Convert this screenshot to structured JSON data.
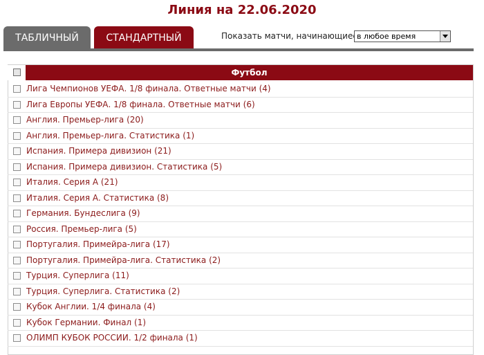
{
  "page": {
    "title": "Линия на 22.06.2020"
  },
  "tabs": [
    {
      "label": "ТАБЛИЧНЫЙ",
      "active": false
    },
    {
      "label": "СТАНДАРТНЫЙ",
      "active": true
    }
  ],
  "filter": {
    "label": "Показать матчи, начинающиеся",
    "selected": "в любое время"
  },
  "table": {
    "header": "Футбол",
    "rows": [
      {
        "label": "Лига Чемпионов УЕФА. 1/8 финала. Ответные матчи (4)"
      },
      {
        "label": "Лига Европы УЕФА. 1/8 финала. Ответные матчи (6)"
      },
      {
        "label": "Англия. Премьер-лига (20)"
      },
      {
        "label": "Англия. Премьер-лига. Статистика (1)"
      },
      {
        "label": "Испания. Примера дивизион (21)"
      },
      {
        "label": "Испания. Примера дивизион. Статистика (5)"
      },
      {
        "label": "Италия. Серия А (21)"
      },
      {
        "label": "Италия. Серия А. Статистика (8)"
      },
      {
        "label": "Германия. Бундеслига (9)"
      },
      {
        "label": "Россия. Премьер-лига (5)"
      },
      {
        "label": "Португалия. Примейра-лига (17)"
      },
      {
        "label": "Португалия. Примейра-лига. Статистика (2)"
      },
      {
        "label": "Турция. Суперлига (11)"
      },
      {
        "label": "Турция. Суперлига. Статистика (2)"
      },
      {
        "label": "Кубок Англии. 1/4 финала (4)"
      },
      {
        "label": "Кубок Германии. Финал (1)"
      },
      {
        "label": "ОЛИМП КУБОК РОССИИ. 1/2 финала (1)"
      }
    ]
  },
  "colors": {
    "accent": "#8b0a14",
    "tab_inactive": "#6b6b6b",
    "link": "#8b1a1a"
  }
}
